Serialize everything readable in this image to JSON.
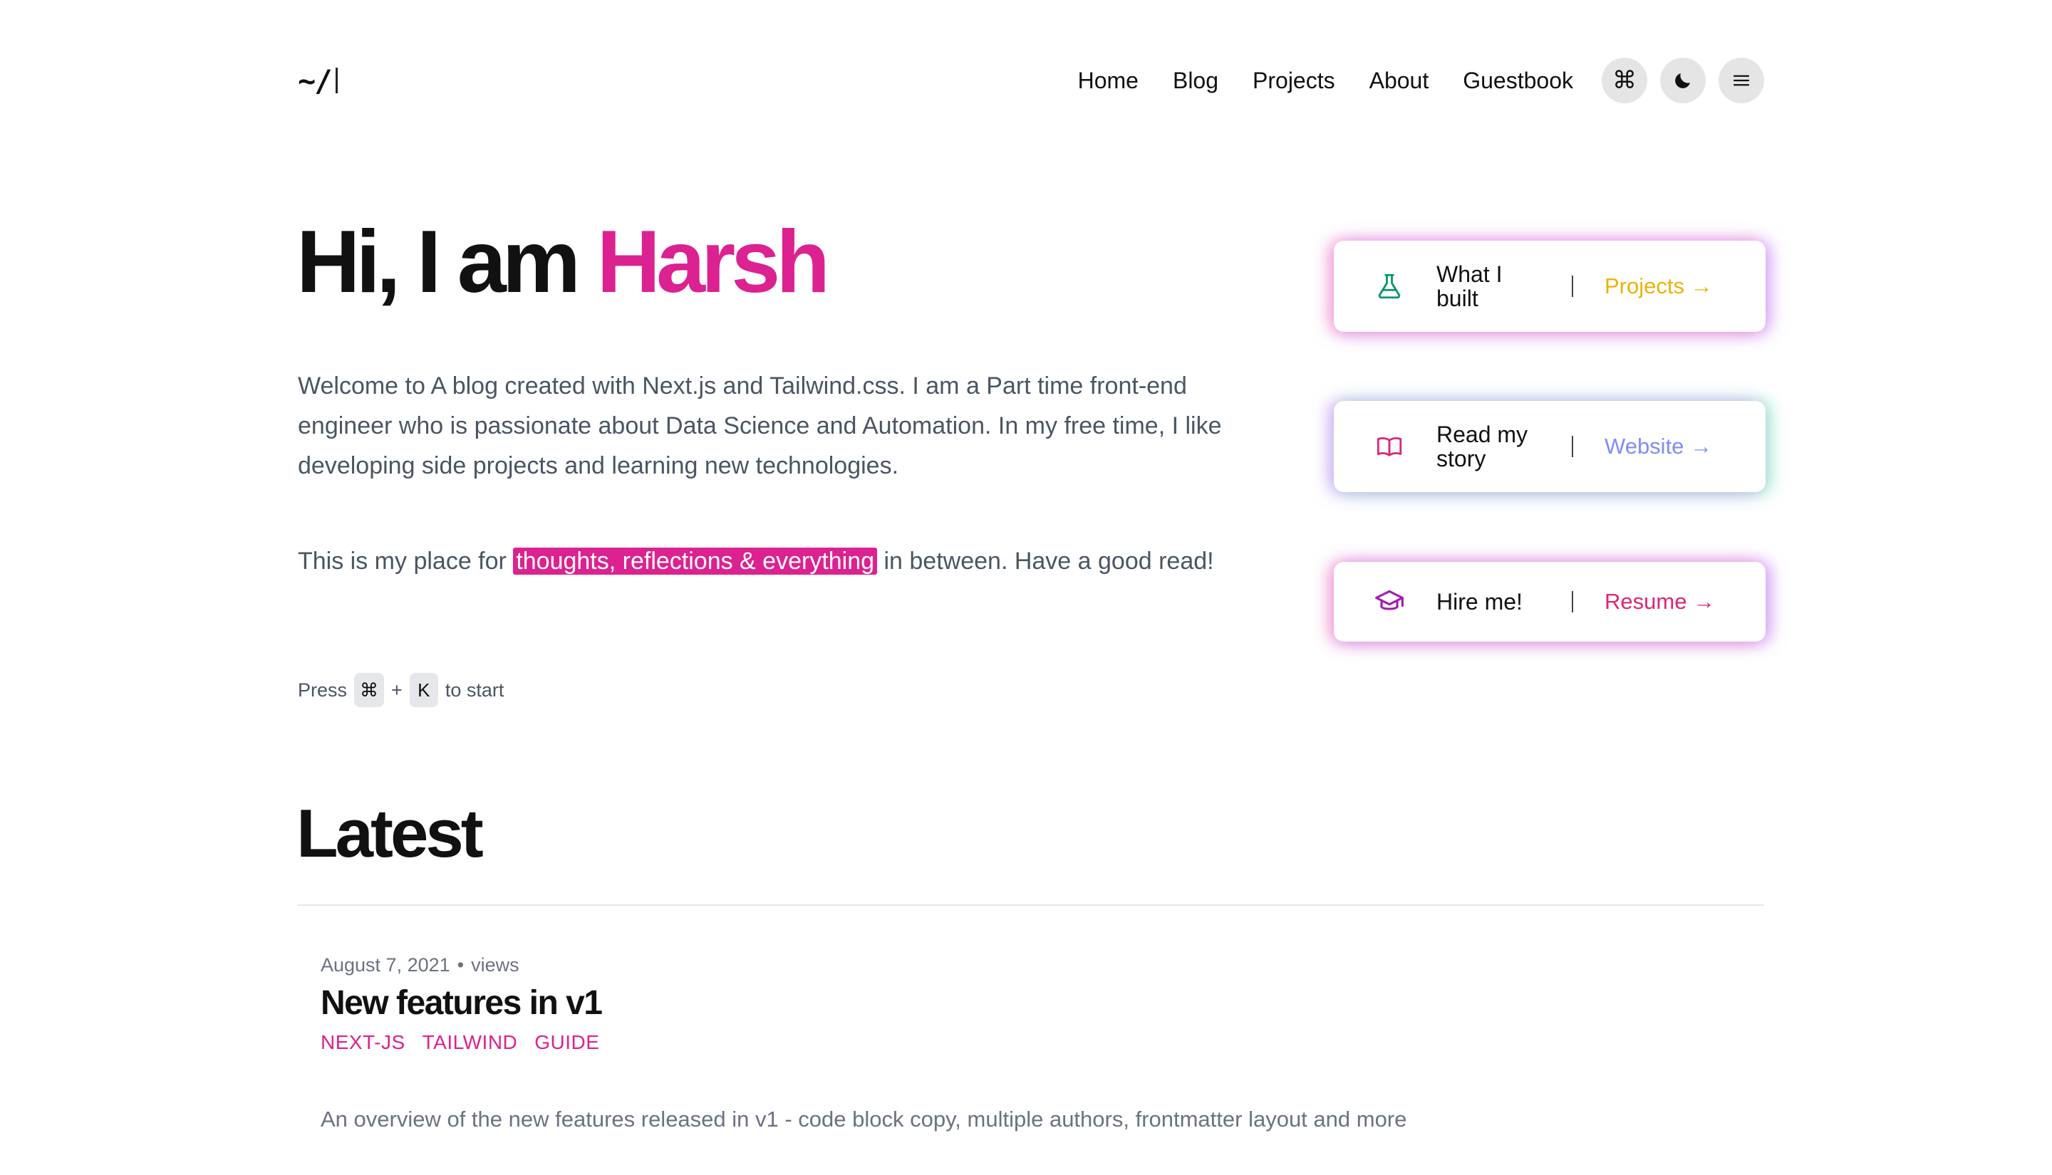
{
  "header": {
    "logo": "~/",
    "nav": [
      "Home",
      "Blog",
      "Projects",
      "About",
      "Guestbook"
    ],
    "buttons": {
      "command": "⌘",
      "theme": "☾",
      "menu": "≡"
    }
  },
  "hero": {
    "greeting": "Hi, I am ",
    "name": "Harsh",
    "intro": "Welcome to A blog created with Next.js and Tailwind.css. I am a Part time front-end engineer who is passionate about Data Science and Automation. In my free time, I like developing side projects and learning new technologies.",
    "tagline_before": "This is my place for ",
    "tagline_highlight": "thoughts, reflections & everything",
    "tagline_after": " in between. Have a good read!",
    "press": {
      "prefix": "Press",
      "key1": "⌘",
      "plus": "+",
      "key2": "K",
      "suffix": "to start"
    }
  },
  "cards": [
    {
      "label": "What I built",
      "link": "Projects →",
      "color": "#eab308",
      "icon": "beaker-icon",
      "icon_color": "#059669"
    },
    {
      "label": "Read my story",
      "link": "Website →",
      "color": "#818cf8",
      "icon": "book-open-icon",
      "icon_color": "#db2777"
    },
    {
      "label": "Hire me!",
      "link": "Resume →",
      "color": "#db2777",
      "icon": "academic-cap-icon",
      "icon_color": "#a21caf"
    }
  ],
  "latest": {
    "title": "Latest",
    "posts": [
      {
        "date": "August 7, 2021",
        "separator": "•",
        "views": "views",
        "title": "New features in v1",
        "tags": [
          "NEXT-JS",
          "TAILWIND",
          "GUIDE"
        ],
        "summary": "An overview of the new features released in v1 - code block copy, multiple authors, frontmatter layout and more"
      }
    ]
  }
}
